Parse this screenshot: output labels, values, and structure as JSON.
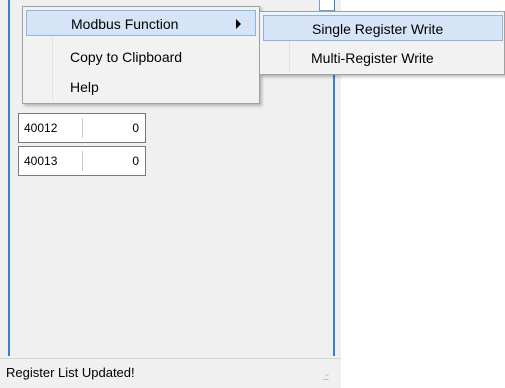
{
  "registers": [
    {
      "address": "40012",
      "value": "0"
    },
    {
      "address": "40013",
      "value": "0"
    }
  ],
  "status_bar": {
    "text": "Register List Updated!",
    "grip_glyph": ".::"
  },
  "context_menu": {
    "items": [
      {
        "label": "Modbus Function",
        "has_submenu": true,
        "highlighted": true
      },
      {
        "label": "Copy to Clipboard",
        "has_submenu": false,
        "highlighted": false
      },
      {
        "label": "Help",
        "has_submenu": false,
        "highlighted": false
      }
    ]
  },
  "submenu": {
    "items": [
      {
        "label": "Single Register Write",
        "highlighted": true
      },
      {
        "label": "Multi-Register Write",
        "highlighted": false
      }
    ]
  },
  "colors": {
    "highlight_bg": "#d5e5f7",
    "highlight_border": "#86b8e6",
    "window_accent": "#3c7fd1"
  }
}
